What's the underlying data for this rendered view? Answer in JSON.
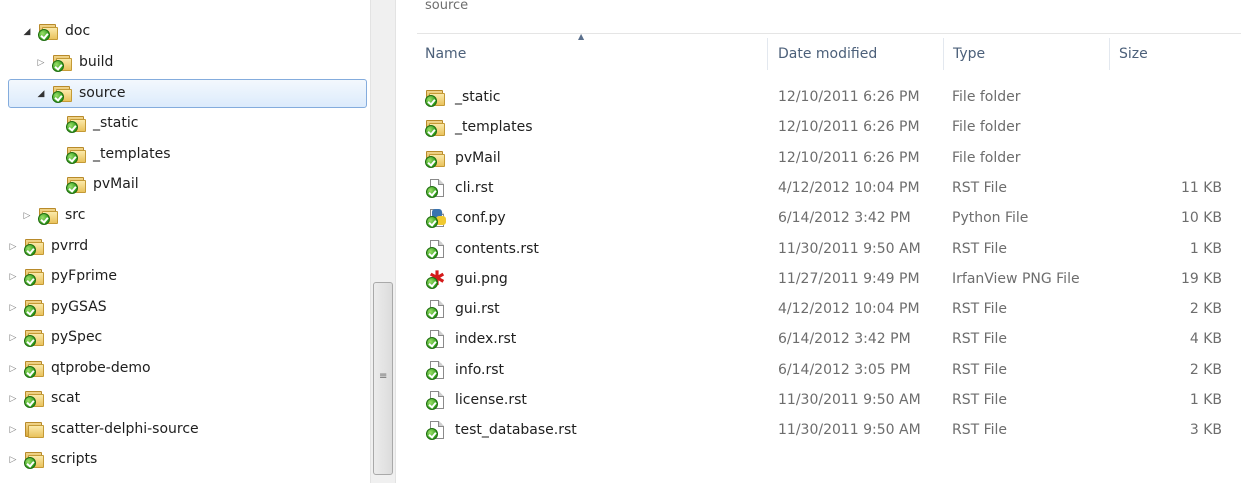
{
  "tree": {
    "items": [
      {
        "label": "doc",
        "expander": "open",
        "selected": false
      },
      {
        "label": "build",
        "expander": "closed",
        "selected": false
      },
      {
        "label": "source",
        "expander": "open",
        "selected": true
      },
      {
        "label": "_static",
        "expander": "none",
        "selected": false
      },
      {
        "label": "_templates",
        "expander": "none",
        "selected": false
      },
      {
        "label": "pvMail",
        "expander": "none",
        "selected": false
      },
      {
        "label": "src",
        "expander": "closed",
        "selected": false
      },
      {
        "label": "pvrrd",
        "expander": "closed",
        "selected": false
      },
      {
        "label": "pyFprime",
        "expander": "closed",
        "selected": false
      },
      {
        "label": "pyGSAS",
        "expander": "closed",
        "selected": false
      },
      {
        "label": "pySpec",
        "expander": "closed",
        "selected": false
      },
      {
        "label": "qtprobe-demo",
        "expander": "closed",
        "selected": false
      },
      {
        "label": "scat",
        "expander": "closed",
        "selected": false
      },
      {
        "label": "scatter-delphi-source",
        "expander": "closed",
        "selected": false
      },
      {
        "label": "scripts",
        "expander": "closed",
        "selected": false
      }
    ]
  },
  "list": {
    "path_label": "source",
    "columns": {
      "name": "Name",
      "date": "Date modified",
      "type": "Type",
      "size": "Size"
    },
    "files": [
      {
        "name": "_static",
        "date": "12/10/2011 6:26 PM",
        "type": "File folder",
        "size": "",
        "icon": "folder-icon"
      },
      {
        "name": "_templates",
        "date": "12/10/2011 6:26 PM",
        "type": "File folder",
        "size": "",
        "icon": "folder-icon"
      },
      {
        "name": "pvMail",
        "date": "12/10/2011 6:26 PM",
        "type": "File folder",
        "size": "",
        "icon": "folder-icon"
      },
      {
        "name": "cli.rst",
        "date": "4/12/2012 10:04 PM",
        "type": "RST File",
        "size": "11 KB",
        "icon": "document-icon"
      },
      {
        "name": "conf.py",
        "date": "6/14/2012 3:42 PM",
        "type": "Python File",
        "size": "10 KB",
        "icon": "python-file-icon"
      },
      {
        "name": "contents.rst",
        "date": "11/30/2011 9:50 AM",
        "type": "RST File",
        "size": "1 KB",
        "icon": "document-icon"
      },
      {
        "name": "gui.png",
        "date": "11/27/2011 9:49 PM",
        "type": "IrfanView PNG File",
        "size": "19 KB",
        "icon": "image-file-icon"
      },
      {
        "name": "gui.rst",
        "date": "4/12/2012 10:04 PM",
        "type": "RST File",
        "size": "2 KB",
        "icon": "document-icon"
      },
      {
        "name": "index.rst",
        "date": "6/14/2012 3:42 PM",
        "type": "RST File",
        "size": "4 KB",
        "icon": "document-icon"
      },
      {
        "name": "info.rst",
        "date": "6/14/2012 3:05 PM",
        "type": "RST File",
        "size": "2 KB",
        "icon": "document-icon"
      },
      {
        "name": "license.rst",
        "date": "11/30/2011 9:50 AM",
        "type": "RST File",
        "size": "1 KB",
        "icon": "document-icon"
      },
      {
        "name": "test_database.rst",
        "date": "11/30/2011 9:50 AM",
        "type": "RST File",
        "size": "3 KB",
        "icon": "document-icon"
      }
    ]
  }
}
